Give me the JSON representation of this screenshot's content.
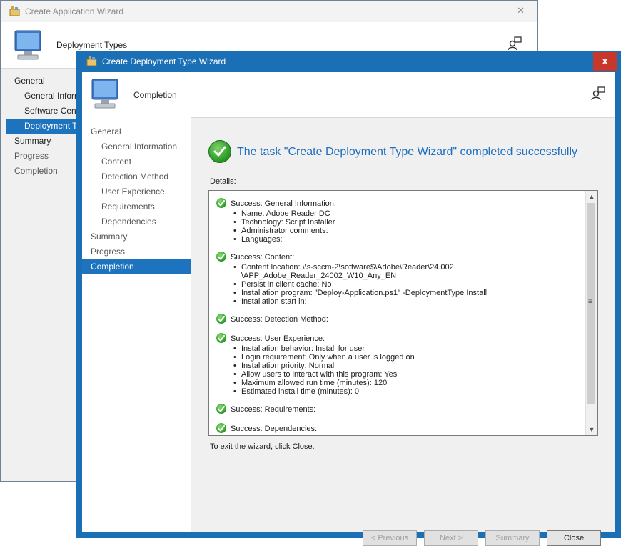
{
  "parent_wizard": {
    "title": "Create Application Wizard",
    "header_title": "Deployment Types",
    "nav": [
      {
        "label": "General",
        "level": "top",
        "state": "normal"
      },
      {
        "label": "General Information",
        "level": "sub",
        "state": "normal"
      },
      {
        "label": "Software Center",
        "level": "sub",
        "state": "normal"
      },
      {
        "label": "Deployment Types",
        "level": "sub",
        "state": "selected"
      },
      {
        "label": "Summary",
        "level": "top",
        "state": "normal"
      },
      {
        "label": "Progress",
        "level": "top",
        "state": "dim"
      },
      {
        "label": "Completion",
        "level": "top",
        "state": "dim"
      }
    ]
  },
  "wizard": {
    "title": "Create Deployment Type Wizard",
    "header_title": "Completion",
    "close_glyph": "x",
    "nav": [
      {
        "label": "General",
        "level": "top"
      },
      {
        "label": "General Information",
        "level": "sub"
      },
      {
        "label": "Content",
        "level": "sub"
      },
      {
        "label": "Detection Method",
        "level": "sub"
      },
      {
        "label": "User Experience",
        "level": "sub"
      },
      {
        "label": "Requirements",
        "level": "sub"
      },
      {
        "label": "Dependencies",
        "level": "sub"
      },
      {
        "label": "Summary",
        "level": "top"
      },
      {
        "label": "Progress",
        "level": "top"
      },
      {
        "label": "Completion",
        "level": "top",
        "selected": true
      }
    ],
    "completion_message": "The task \"Create Deployment Type Wizard\" completed successfully",
    "details_label": "Details:",
    "details": [
      {
        "heading": "Success: General Information:",
        "items": [
          "Name: Adobe Reader DC",
          "Technology: Script Installer",
          "Administrator comments:",
          "Languages:"
        ]
      },
      {
        "heading": "Success: Content:",
        "items": [
          "Content location: \\\\s-sccm-2\\software$\\Adobe\\Reader\\24.002\n\\APP_Adobe_Reader_24002_W10_Any_EN",
          "Persist in client cache: No",
          "Installation program: \"Deploy-Application.ps1\" -DeploymentType Install",
          "Installation start in:"
        ]
      },
      {
        "heading": "Success: Detection Method:",
        "items": []
      },
      {
        "heading": "Success: User Experience:",
        "items": [
          "Installation behavior: Install for user",
          "Login requirement: Only when a user is logged on",
          "Installation priority: Normal",
          "Allow users to interact with this program: Yes",
          "Maximum allowed run time (minutes): 120",
          "Estimated install time (minutes): 0"
        ]
      },
      {
        "heading": "Success: Requirements:",
        "items": []
      },
      {
        "heading": "Success: Dependencies:",
        "items": []
      }
    ],
    "exit_hint": "To exit the wizard, click Close.",
    "buttons": {
      "previous": "< Previous",
      "next": "Next >",
      "summary": "Summary",
      "close": "Close"
    }
  },
  "colors": {
    "title_bar_active": "#1a6fb5",
    "close_button": "#c7382b",
    "selected_nav": "#1e73be",
    "success_text": "#1f6fbf",
    "success_icon": "#2f9f2a"
  },
  "icons": [
    "app-wizard-icon",
    "computer-icon",
    "help-user-icon",
    "success-check-icon",
    "close-icon"
  ]
}
